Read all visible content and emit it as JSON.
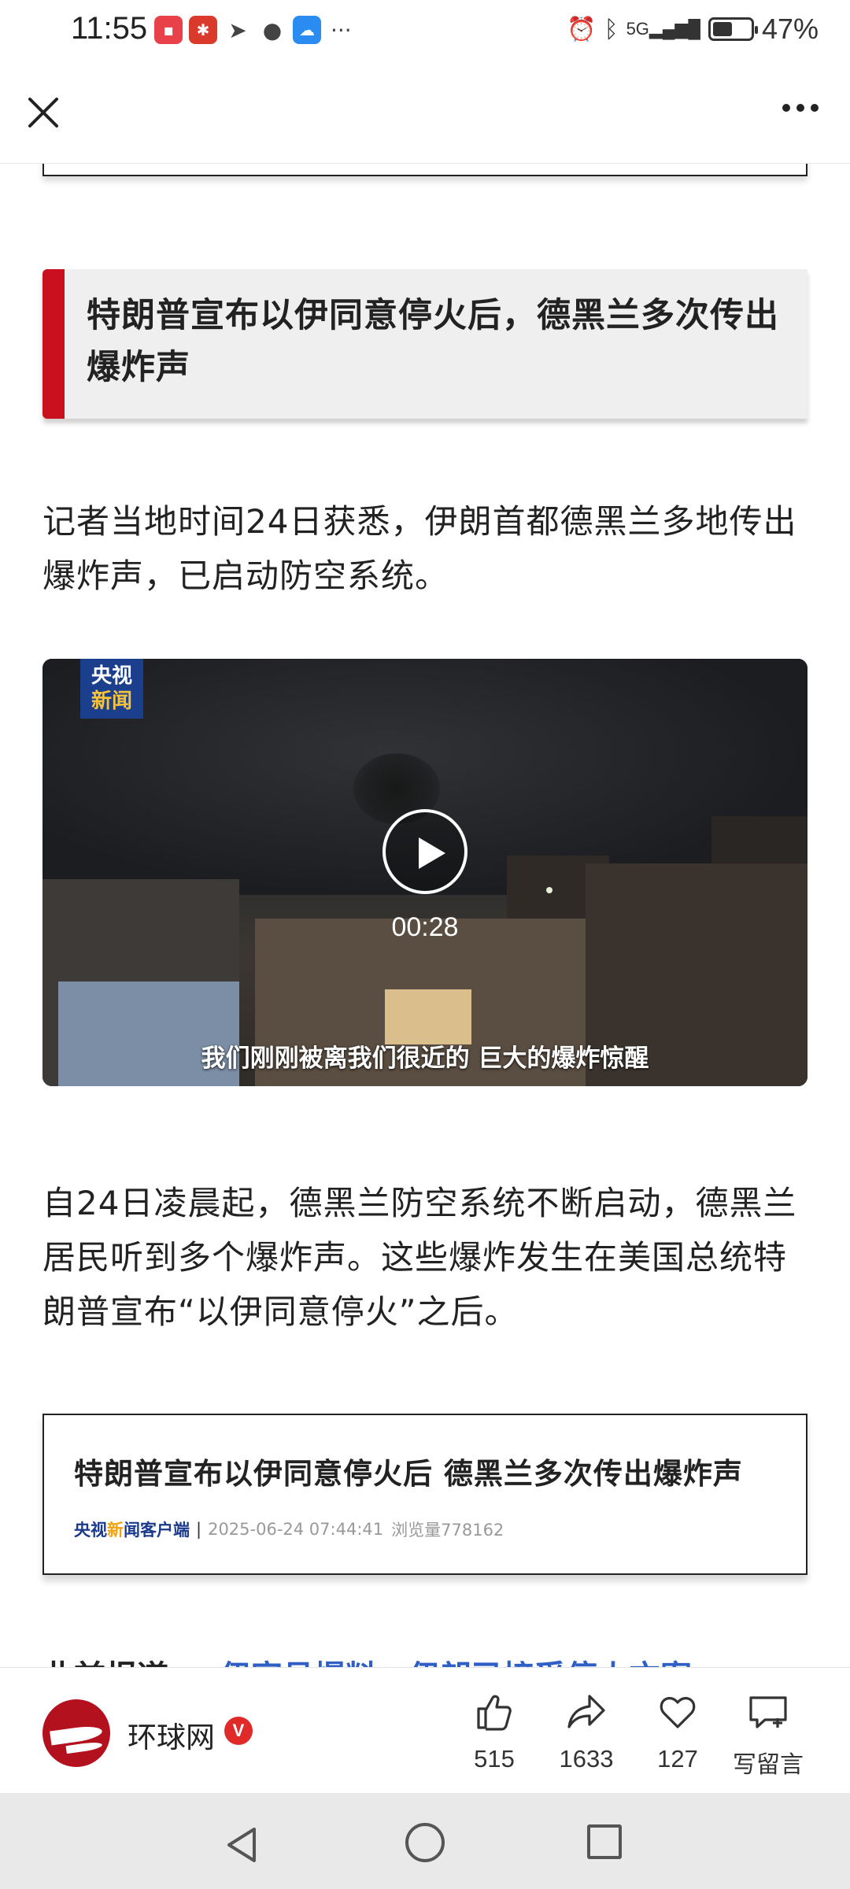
{
  "status_bar": {
    "time": "11:55",
    "battery_percent": "47%",
    "battery_level": 0.47,
    "network": "5G",
    "notification_icons": [
      "huawei-app-icon",
      "gift-app-icon",
      "telegram-icon",
      "message-icon",
      "weather-icon"
    ],
    "more_notifications": "···"
  },
  "nav": {
    "close_icon": "close-icon",
    "more_icon": "more-options-icon"
  },
  "article": {
    "section_heading": "特朗普宣布以伊同意停火后，德黑兰多次传出爆炸声",
    "paragraph_1": "记者当地时间24日获悉，伊朗首都德黑兰多地传出爆炸声，已启动防空系统。",
    "video": {
      "logo_line1": "央视",
      "logo_line2": "新闻",
      "duration": "00:28",
      "subtitle": "我们刚刚被离我们很近的 巨大的爆炸惊醒"
    },
    "paragraph_2": "自24日凌晨起，德黑兰防空系统不断启动，德黑兰居民听到多个爆炸声。这些爆炸发生在美国总统特朗普宣布“以伊同意停火”之后。",
    "quote_card": {
      "title": "特朗普宣布以伊同意停火后 德黑兰多次传出爆炸声",
      "source_part1": "央视",
      "source_part2": "新",
      "source_part3": "闻客户端",
      "separator": "|",
      "datetime": "2025-06-24 07:44:41",
      "views": "浏览量778162"
    },
    "partial_line": {
      "bold_text": "此前报道",
      "link_text": "伊官员爆料：伊朗已接受停火方案"
    }
  },
  "action_bar": {
    "publisher_name": "环球网",
    "verified_badge": "V",
    "like_count": "515",
    "share_count": "1633",
    "favorite_count": "127",
    "comment_label": "写留言",
    "accent_color": "#c8101e"
  },
  "system_nav": {
    "back": "back-icon",
    "home": "home-icon",
    "recent": "recent-apps-icon"
  }
}
